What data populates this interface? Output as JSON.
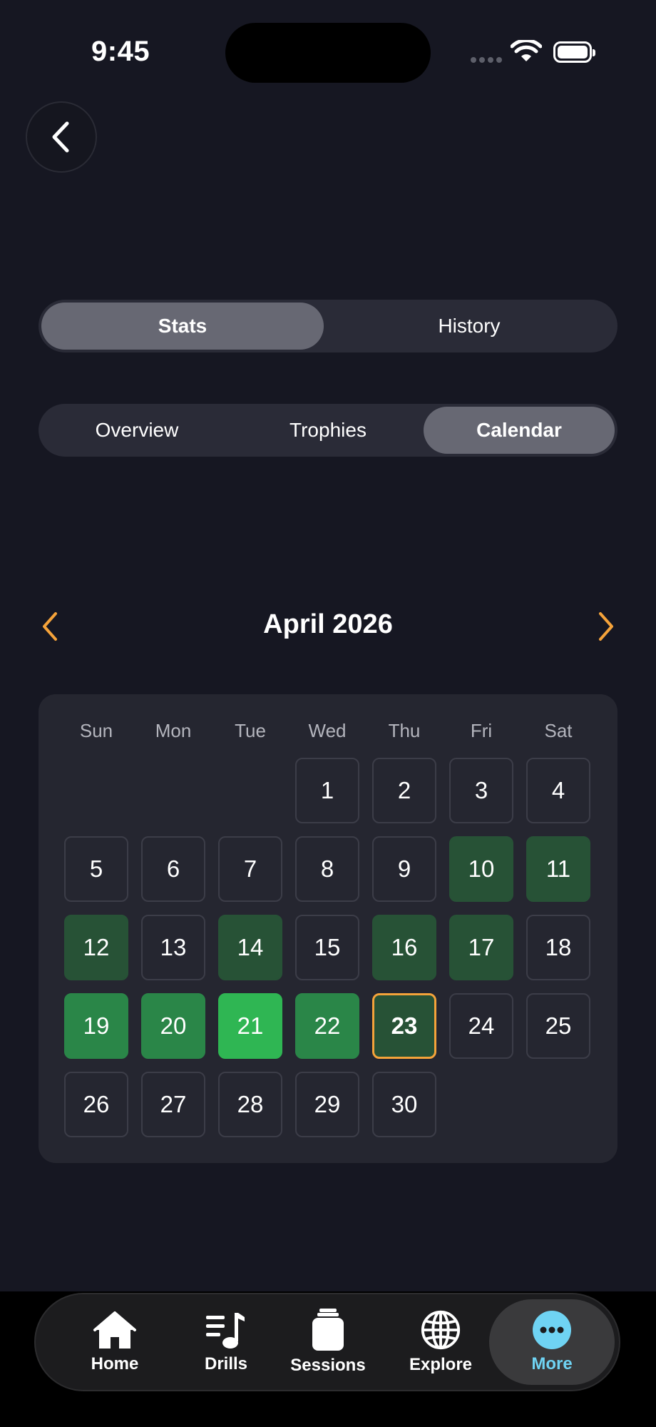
{
  "status_bar": {
    "time": "9:45"
  },
  "segments_top": [
    {
      "label": "Stats",
      "active": true
    },
    {
      "label": "History",
      "active": false
    }
  ],
  "segments_sub": [
    {
      "label": "Overview",
      "active": false
    },
    {
      "label": "Trophies",
      "active": false
    },
    {
      "label": "Calendar",
      "active": true
    }
  ],
  "calendar": {
    "month_label": "April 2026",
    "weekdays": [
      "Sun",
      "Mon",
      "Tue",
      "Wed",
      "Thu",
      "Fri",
      "Sat"
    ],
    "first_weekday_index": 3,
    "days": [
      {
        "d": "1",
        "level": 0
      },
      {
        "d": "2",
        "level": 0
      },
      {
        "d": "3",
        "level": 0
      },
      {
        "d": "4",
        "level": 0
      },
      {
        "d": "5",
        "level": 0
      },
      {
        "d": "6",
        "level": 0
      },
      {
        "d": "7",
        "level": 0
      },
      {
        "d": "8",
        "level": 0
      },
      {
        "d": "9",
        "level": 0
      },
      {
        "d": "10",
        "level": 1
      },
      {
        "d": "11",
        "level": 1
      },
      {
        "d": "12",
        "level": 1
      },
      {
        "d": "13",
        "level": 0
      },
      {
        "d": "14",
        "level": 1
      },
      {
        "d": "15",
        "level": 0
      },
      {
        "d": "16",
        "level": 1
      },
      {
        "d": "17",
        "level": 1
      },
      {
        "d": "18",
        "level": 0
      },
      {
        "d": "19",
        "level": 2
      },
      {
        "d": "20",
        "level": 2
      },
      {
        "d": "21",
        "level": 3
      },
      {
        "d": "22",
        "level": 2
      },
      {
        "d": "23",
        "level": 1,
        "today": true
      },
      {
        "d": "24",
        "level": 0
      },
      {
        "d": "25",
        "level": 0
      },
      {
        "d": "26",
        "level": 0
      },
      {
        "d": "27",
        "level": 0
      },
      {
        "d": "28",
        "level": 0
      },
      {
        "d": "29",
        "level": 0
      },
      {
        "d": "30",
        "level": 0
      }
    ],
    "colors": {
      "accent_arrow": "#f5a33a",
      "today_border": "#f5a33a",
      "level_1": "#275236",
      "level_2": "#2a8648",
      "level_3": "#2fb653"
    }
  },
  "tab_bar": {
    "items": [
      {
        "label": "Home",
        "icon": "house-icon",
        "active": false
      },
      {
        "label": "Drills",
        "icon": "music-list-icon",
        "active": false
      },
      {
        "label": "Sessions",
        "icon": "jar-icon",
        "active": false
      },
      {
        "label": "Explore",
        "icon": "globe-icon",
        "active": false
      },
      {
        "label": "More",
        "icon": "more-ellipsis-icon",
        "active": true
      }
    ],
    "active_color": "#6fd3f3"
  }
}
